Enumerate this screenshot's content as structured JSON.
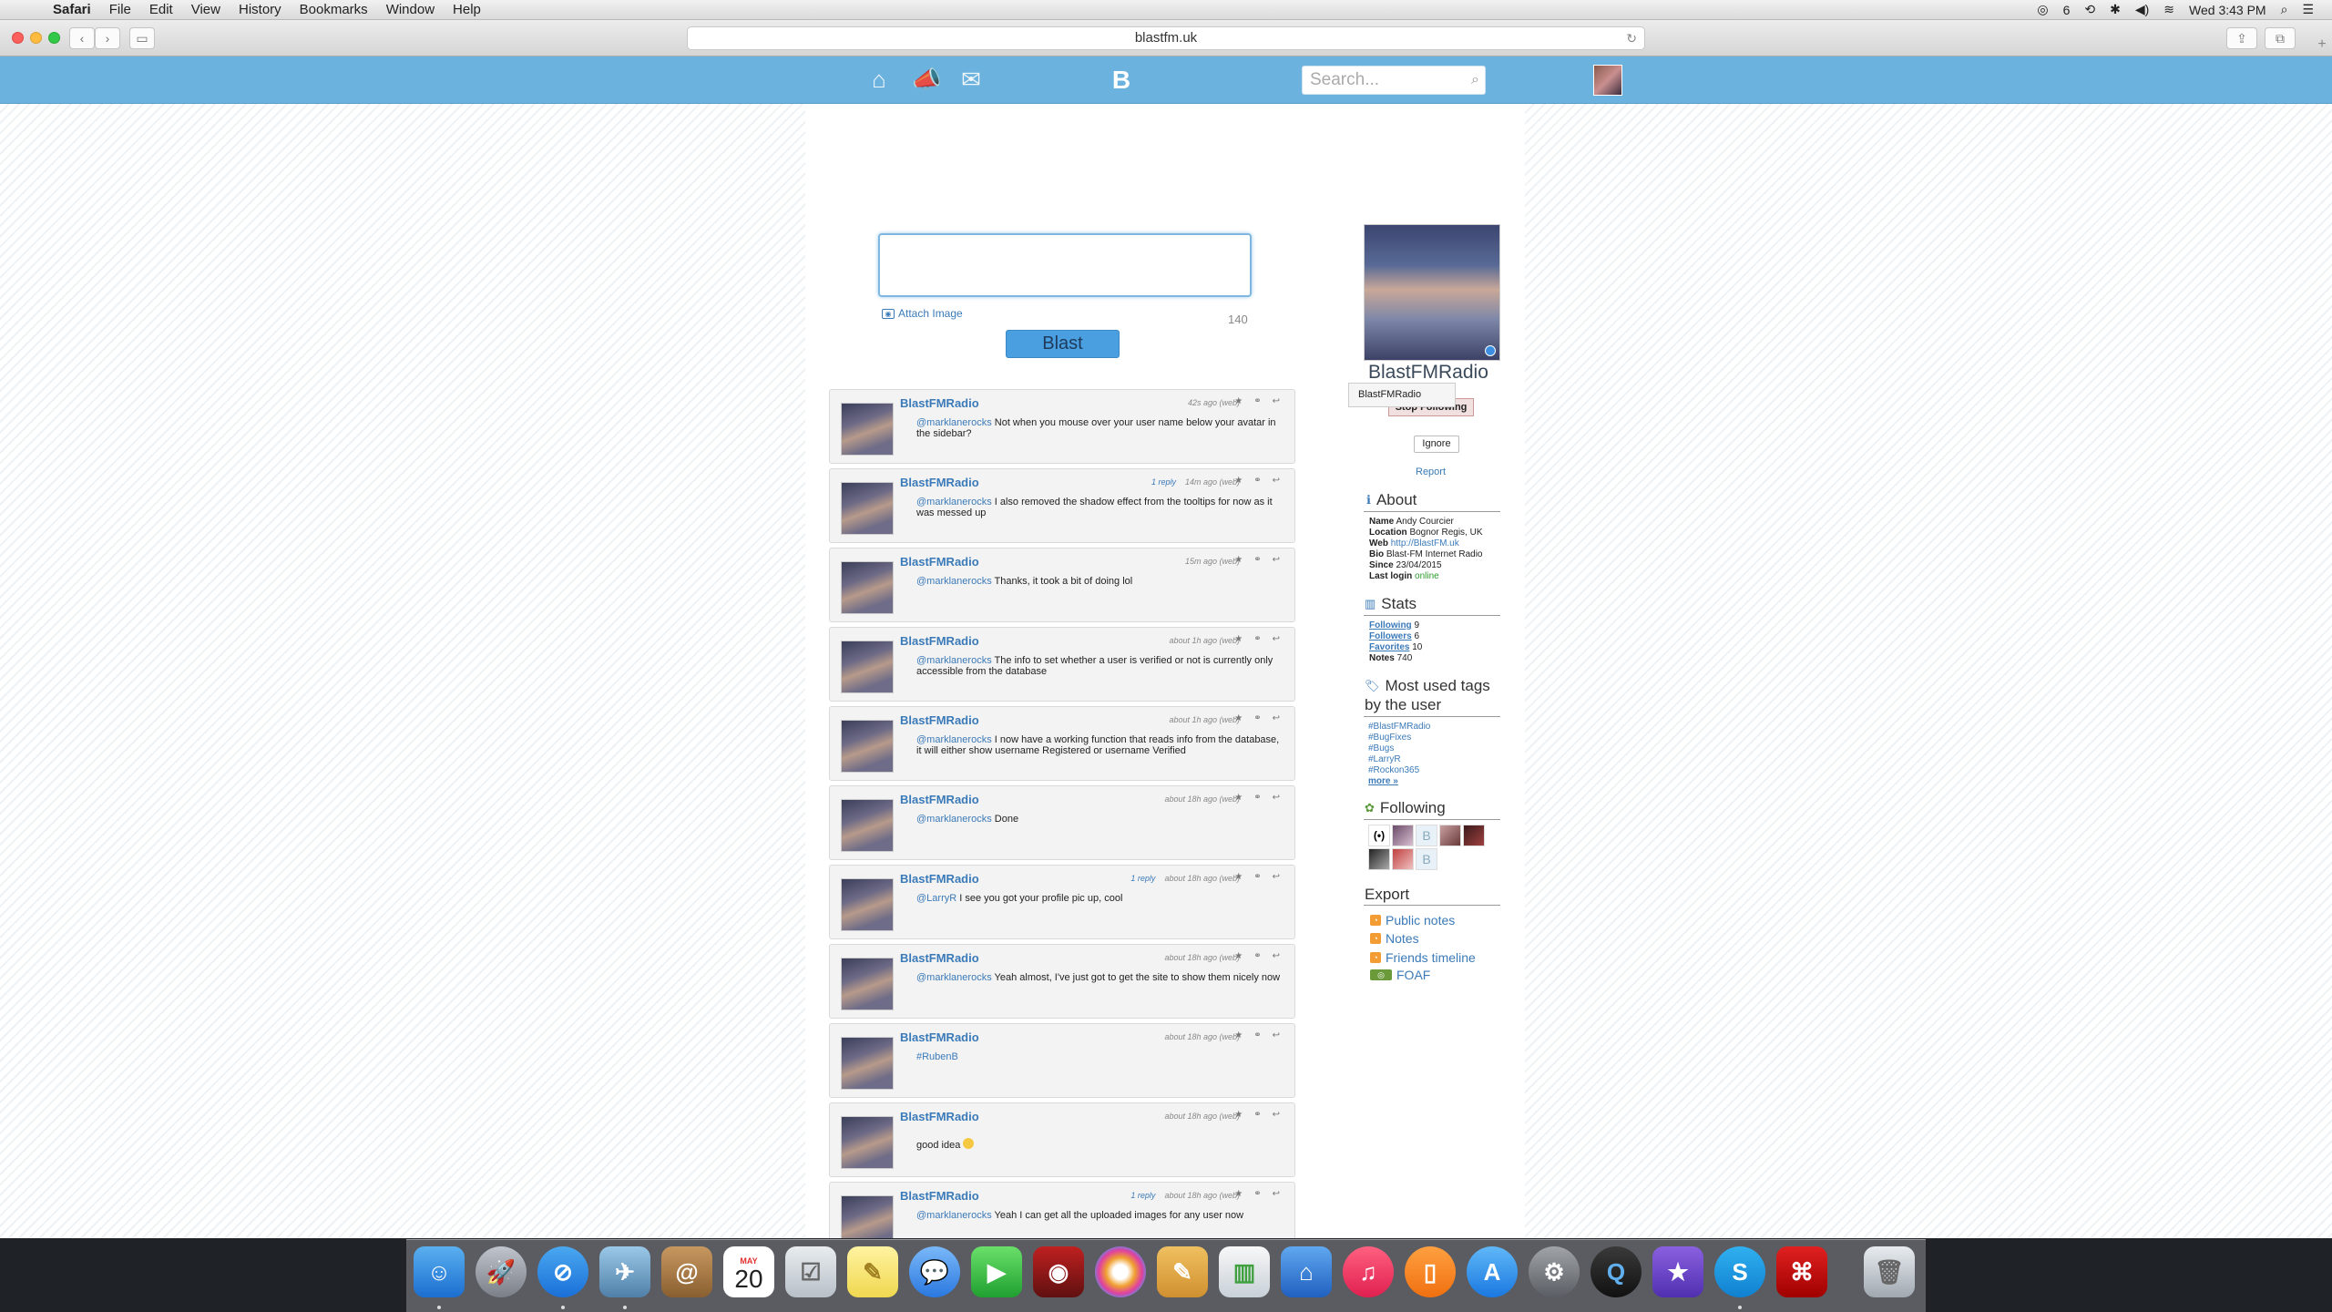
{
  "menubar": {
    "app_name": "Safari",
    "items": [
      "File",
      "Edit",
      "View",
      "History",
      "Bookmarks",
      "Window",
      "Help"
    ],
    "battery_count": "6",
    "clock": "Wed 3:43 PM"
  },
  "browser": {
    "url": "blastfm.uk"
  },
  "site": {
    "search_placeholder": "Search..."
  },
  "composer": {
    "attach_label": "Attach Image",
    "char_count": "140",
    "blast_label": "Blast"
  },
  "feed": [
    {
      "user": "BlastFMRadio",
      "reply": "",
      "time": "42s ago (web)",
      "mention": "@marklanerocks",
      "text": " Not when you mouse over your user name below your avatar in the sidebar?"
    },
    {
      "user": "BlastFMRadio",
      "reply": "1 reply",
      "time": "14m ago (web)",
      "mention": "@marklanerocks",
      "text": " I also removed the shadow effect from the tooltips for now as it was messed up"
    },
    {
      "user": "BlastFMRadio",
      "reply": "",
      "time": "15m ago (web)",
      "mention": "@marklanerocks",
      "text": " Thanks, it took a bit of doing lol"
    },
    {
      "user": "BlastFMRadio",
      "reply": "",
      "time": "about 1h ago (web)",
      "mention": "@marklanerocks",
      "text": " The info to set whether a user is verified or not is currently only accessible from the database"
    },
    {
      "user": "BlastFMRadio",
      "reply": "",
      "time": "about 1h ago (web)",
      "mention": "@marklanerocks",
      "text": " I now have a working function that reads info from the database, it will either show username Registered or username Verified"
    },
    {
      "user": "BlastFMRadio",
      "reply": "",
      "time": "about 18h ago (web)",
      "mention": "@marklanerocks",
      "text": " Done"
    },
    {
      "user": "BlastFMRadio",
      "reply": "1 reply",
      "time": "about 18h ago (web)",
      "mention": "@LarryR",
      "text": " I see you got your profile pic up, cool"
    },
    {
      "user": "BlastFMRadio",
      "reply": "",
      "time": "about 18h ago (web)",
      "mention": "@marklanerocks",
      "text": " Yeah almost, I've just got to get the site to show them nicely now"
    },
    {
      "user": "BlastFMRadio",
      "reply": "",
      "time": "about 18h ago (web)",
      "mention": "#RubenB",
      "text": ""
    },
    {
      "user": "BlastFMRadio",
      "reply": "",
      "time": "about 18h ago (web)",
      "mention": "",
      "text": "good idea"
    },
    {
      "user": "BlastFMRadio",
      "reply": "1 reply",
      "time": "about 18h ago (web)",
      "mention": "@marklanerocks",
      "text": " Yeah I can get all the uploaded images for any user now"
    }
  ],
  "profile": {
    "name": "BlastFMRadio",
    "tooltip": "BlastFMRadio",
    "stop_following": "Stop Following",
    "ignore": "Ignore",
    "report": "Report"
  },
  "about": {
    "title": "About",
    "name_label": "Name",
    "name": "Andy Courcier",
    "location_label": "Location",
    "location": "Bognor Regis, UK",
    "web_label": "Web",
    "web": "http://BlastFM.uk",
    "bio_label": "Bio",
    "bio": "Blast-FM Internet Radio",
    "since_label": "Since",
    "since": "23/04/2015",
    "lastlogin_label": "Last login",
    "lastlogin": "online"
  },
  "stats": {
    "title": "Stats",
    "following_label": "Following",
    "following": "9",
    "followers_label": "Followers",
    "followers": "6",
    "favorites_label": "Favorites",
    "favorites": "10",
    "notes_label": "Notes",
    "notes": "740"
  },
  "tags": {
    "title_line1": "Most used tags",
    "title_line2": "by the user",
    "items": [
      "#BlastFMRadio",
      "#BugFixes",
      "#Bugs",
      "#LarryR",
      "#Rockon365"
    ],
    "more": "more »"
  },
  "following": {
    "title": "Following"
  },
  "export": {
    "title": "Export",
    "items": [
      "Public notes",
      "Notes",
      "Friends timeline",
      "FOAF"
    ]
  },
  "dock": {
    "calendar_month": "MAY",
    "calendar_day": "20"
  }
}
